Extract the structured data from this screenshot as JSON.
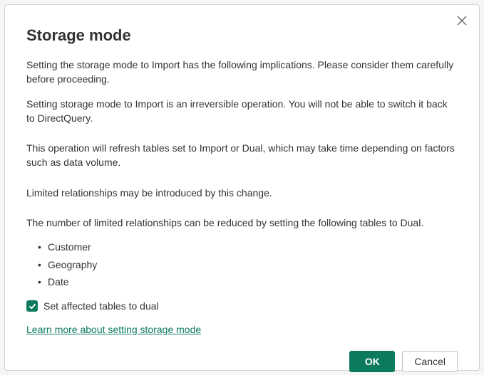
{
  "dialog": {
    "title": "Storage mode",
    "close_label": "Close",
    "paragraphs": {
      "p1": "Setting the storage mode to Import has the following implications. Please consider them carefully before proceeding.",
      "p2": "Setting storage mode to Import is an irreversible operation.  You will not be able to switch it back to DirectQuery.",
      "p3": "This operation will refresh tables set to Import or Dual, which may take time depending on factors such as data volume.",
      "p4": "Limited relationships may be introduced by this change.",
      "p5": "The number of limited relationships can be reduced by setting the following tables to Dual."
    },
    "tables": [
      "Customer",
      "Geography",
      "Date"
    ],
    "checkbox": {
      "label": "Set affected tables to dual",
      "checked": true
    },
    "link": "Learn more about setting storage mode",
    "buttons": {
      "ok": "OK",
      "cancel": "Cancel"
    }
  },
  "colors": {
    "accent": "#0c7a5d"
  }
}
